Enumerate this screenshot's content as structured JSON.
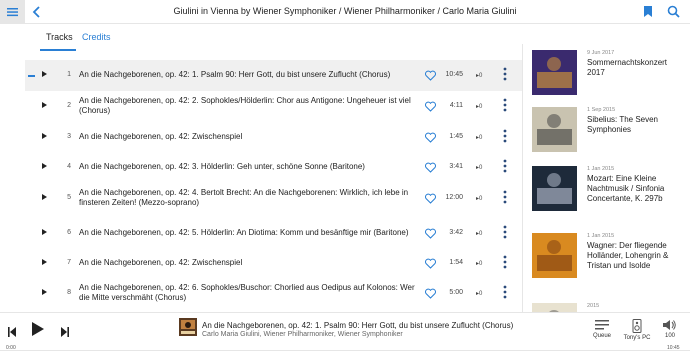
{
  "header": {
    "title": "Giulini in Vienna by Wiener Symphoniker / Wiener Philharmoniker / Carlo Maria Giulini"
  },
  "tabs": [
    {
      "label": "Tracks",
      "active": true
    },
    {
      "label": "Credits",
      "active": false
    }
  ],
  "tracks": [
    {
      "num": "1",
      "title": "An die Nachgeborenen, op. 42: 1. Psalm 90: Herr Gott, du bist unsere Zuflucht (Chorus)",
      "duration": "10:45",
      "plays": "▸0",
      "active": true
    },
    {
      "num": "2",
      "title": "An die Nachgeborenen, op. 42: 2. Sophokles/Hölderlin: Chor aus Antigone: Ungeheuer ist viel (Chorus)",
      "duration": "4:11",
      "plays": "▸0",
      "active": false
    },
    {
      "num": "3",
      "title": "An die Nachgeborenen, op. 42: Zwischenspiel",
      "duration": "1:45",
      "plays": "▸0",
      "active": false
    },
    {
      "num": "4",
      "title": "An die Nachgeborenen, op. 42: 3. Hölderlin: Geh unter, schöne Sonne (Baritone)",
      "duration": "3:41",
      "plays": "▸0",
      "active": false
    },
    {
      "num": "5",
      "title": "An die Nachgeborenen, op. 42: 4. Bertolt Brecht: An die Nachgeborenen: Wirklich, ich lebe in finsteren Zeiten! (Mezzo-soprano)",
      "duration": "12:00",
      "plays": "▸0",
      "active": false
    },
    {
      "num": "6",
      "title": "An die Nachgeborenen, op. 42: 5. Hölderlin: An Diotima: Komm und besänftige mir (Baritone)",
      "duration": "3:42",
      "plays": "▸0",
      "active": false
    },
    {
      "num": "7",
      "title": "An die Nachgeborenen, op. 42: Zwischenspiel",
      "duration": "1:54",
      "plays": "▸0",
      "active": false
    },
    {
      "num": "8",
      "title": "An die Nachgeborenen, op. 42: 6. Sophokles/Buschor: Chorlied aus Oedipus auf Kolonos: Wer die Mitte verschmäht (Chorus)",
      "duration": "5:00",
      "plays": "▸0",
      "active": false
    }
  ],
  "albums": [
    {
      "date": "9 Jun 2017",
      "title": "Sommernachtskonzert 2017",
      "color": "#3a2a6e",
      "accent": "#e0a030"
    },
    {
      "date": "1 Sep 2015",
      "title": "Sibelius: The Seven Symphonies",
      "color": "#c9c3b0",
      "accent": "#3b3b3b"
    },
    {
      "date": "1 Jan 2015",
      "title": "Mozart: Eine Kleine Nachtmusik / Sinfonia Concertante, K. 297b",
      "color": "#1e2a3a",
      "accent": "#c0c8d8"
    },
    {
      "date": "1 Jan 2015",
      "title": "Wagner: Der fliegende Holländer, Lohengrin & Tristan und Isolde",
      "color": "#d98a20",
      "accent": "#7a3a10"
    },
    {
      "date": "2015",
      "title": "",
      "color": "#e8e2d0",
      "accent": "#555555"
    }
  ],
  "player": {
    "title": "An die Nachgeborenen, op. 42: 1. Psalm 90: Herr Gott, du bist unsere Zuflucht (Chorus)",
    "artist": "Carlo Maria Giulini, Wiener Philharmoniker, Wiener Symphoniker",
    "queue_label": "Queue",
    "device_label": "Tony's PC",
    "volume": "100",
    "elapsed": "0:00",
    "total": "10:45",
    "progress": 0
  },
  "colors": {
    "accent": "#2a7fd4",
    "active_row": "#f0f0f0"
  }
}
